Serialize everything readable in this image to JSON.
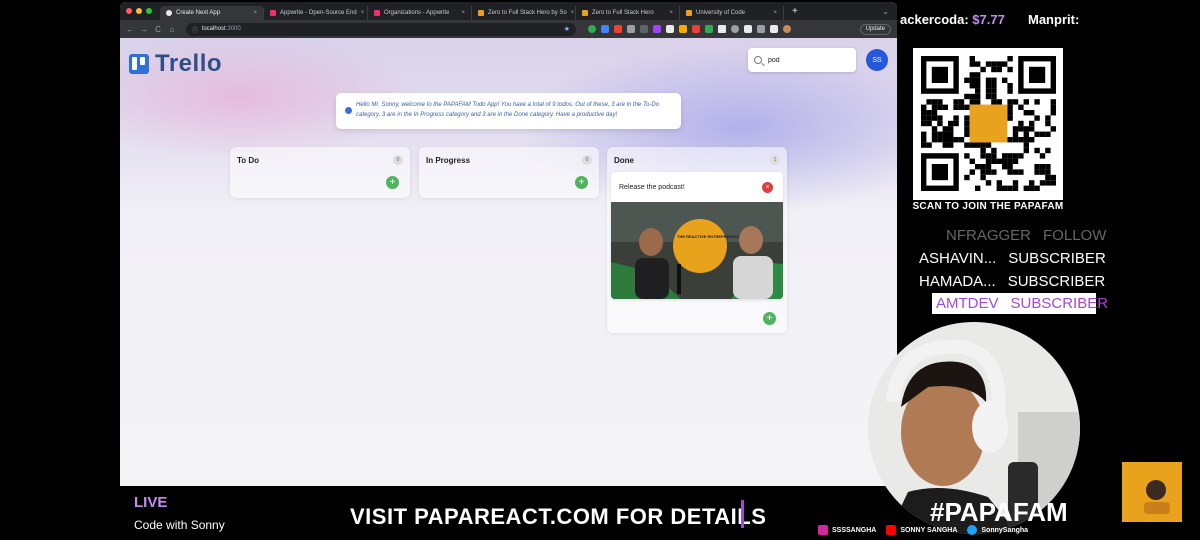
{
  "browser": {
    "tabs": [
      {
        "title": "Create Next App",
        "active": true,
        "color": "#e8eaed"
      },
      {
        "title": "Appwrite - Open-Source End",
        "active": false,
        "color": "#f02e65"
      },
      {
        "title": "Organizations - Appwrite",
        "active": false,
        "color": "#f02e65"
      },
      {
        "title": "Zero to Full Stack Hero by So",
        "active": false,
        "color": "#e9a21c"
      },
      {
        "title": "Zero to Full Stack Hero",
        "active": false,
        "color": "#e9a21c"
      },
      {
        "title": "University of Code",
        "active": false,
        "color": "#e9a21c"
      }
    ],
    "tab_close_glyph": "×",
    "new_tab_glyph": "+",
    "tab_menu_glyph": "⌄",
    "nav": {
      "back": "←",
      "forward": "→",
      "reload": "C",
      "home": "⌂"
    },
    "url_host": "localhost",
    "url_port": ":3000",
    "star_glyph": "★",
    "update_label": "Update"
  },
  "app": {
    "logo_text": "Trello",
    "search_value": "pod",
    "avatar_initials": "SS",
    "welcome_message": "Hello Mr. Sonny, welcome to the PAPAFAM Todo App! You have a total of 9 todos. Out of these, 3 are in the To-Do category, 3 are in the In Progress category and 3 are in the Done category. Have a productive day!",
    "add_glyph": "+",
    "columns": [
      {
        "title": "To Do",
        "count": "0"
      },
      {
        "title": "In Progress",
        "count": "0"
      },
      {
        "title": "Done",
        "count": "1"
      }
    ],
    "card": {
      "title": "Release the podcast!",
      "remove_glyph": "×",
      "image_caption": "THE REACTIVE ENTREPRENEUR"
    }
  },
  "overlay": {
    "tipper_name": "ackercoda:",
    "tipper_amount": "$7.77",
    "tipper_next": "Manprit:",
    "qr_caption": "SCAN TO JOIN THE PAPAFAM",
    "alerts": [
      {
        "name": "NFRAGGER",
        "action": "FOLLOW"
      },
      {
        "name": "ASHAVIN...",
        "action": "SUBSCRIBER"
      },
      {
        "name": "HAMADA...",
        "action": "SUBSCRIBER"
      },
      {
        "name": "AMTDEV",
        "action": "SUBSCRIBER"
      }
    ],
    "live_label": "LIVE",
    "stream_title": "Code with Sonny",
    "promo_text": "VISIT PAPAREACT.COM FOR DETAILS",
    "hashtag": "#PAPAFAM",
    "socials": [
      {
        "handle": "SSSSANGHA",
        "color": "#d6249f"
      },
      {
        "handle": "SONNY SANGHA",
        "color": "#ff0000"
      },
      {
        "handle": "SonnySangha",
        "color": "#1da1f2"
      }
    ]
  }
}
